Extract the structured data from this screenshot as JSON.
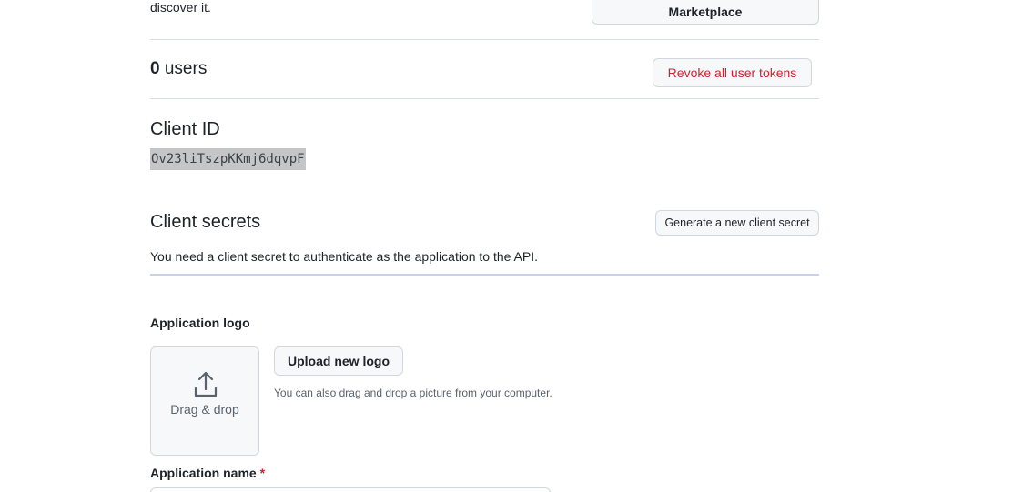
{
  "marketplace": {
    "trailing_text": "discover it.",
    "button_label": "Marketplace"
  },
  "users": {
    "count": "0",
    "label": "users",
    "revoke_label": "Revoke all user tokens"
  },
  "client_id": {
    "heading": "Client ID",
    "value": "Ov23liTszpKKmj6dqvpF"
  },
  "client_secrets": {
    "heading": "Client secrets",
    "generate_label": "Generate a new client secret",
    "note": "You need a client secret to authenticate as the application to the API."
  },
  "app_logo": {
    "label": "Application logo",
    "drop_label": "Drag & drop",
    "upload_label": "Upload new logo",
    "hint": "You can also drag and drop a picture from your computer.",
    "icon": "upload-icon"
  },
  "app_name": {
    "label": "Application name",
    "required_mark": "*",
    "value": ""
  },
  "colors": {
    "danger": "#cf222e",
    "border": "#d0d7de",
    "button_bg": "#f6f8fa",
    "muted_text": "#59636e"
  }
}
